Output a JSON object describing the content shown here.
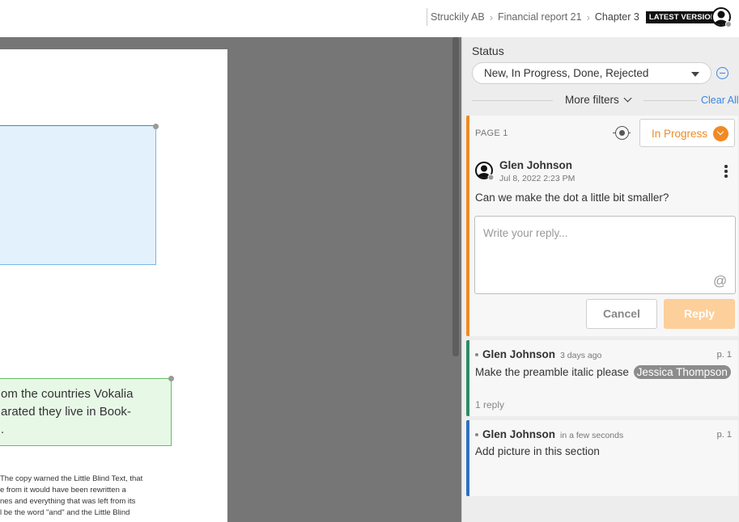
{
  "breadcrumb": {
    "items": [
      "Struckily AB",
      "Financial report 21",
      "Chapter 3"
    ],
    "version_badge": "LATEST VERSION"
  },
  "document": {
    "green_highlight_lines": [
      "om the countries Vokalia",
      "arated they live in Book-",
      "."
    ],
    "body_lines": [
      "The copy warned the Little Blind Text, that",
      "e from it would have been rewritten a",
      "nes and everything that was left from its",
      "l be the word \"and\" and the Little Blind"
    ]
  },
  "filters": {
    "status_label": "Status",
    "status_value": "New, In Progress, Done, Rejected",
    "more_filters": "More filters",
    "clear_all": "Clear All"
  },
  "comments": [
    {
      "page_tag": "PAGE 1",
      "status": "In Progress",
      "author": "Glen Johnson",
      "date": "Jul 8, 2022 2:23 PM",
      "text": "Can we make the dot a little bit smaller?",
      "reply_placeholder": "Write your reply...",
      "at_symbol": "@",
      "cancel_label": "Cancel",
      "reply_label": "Reply",
      "accent": "#f08a24"
    },
    {
      "author": "Glen Johnson",
      "time": "3 days ago",
      "page": "p. 1",
      "text": "Make the preamble italic please",
      "mention": "Jessica Thompson",
      "replies": "1 reply",
      "accent": "#2e8b63"
    },
    {
      "author": "Glen Johnson",
      "time": "in a few seconds",
      "page": "p. 1",
      "text": "Add picture in this section",
      "accent": "#2f6fc2"
    }
  ],
  "colors": {
    "canvas": "#767676",
    "panel": "#ededed",
    "link": "#3a86e0",
    "highlight_blue": "#e3f1fd",
    "highlight_green": "#e8f8e7"
  }
}
